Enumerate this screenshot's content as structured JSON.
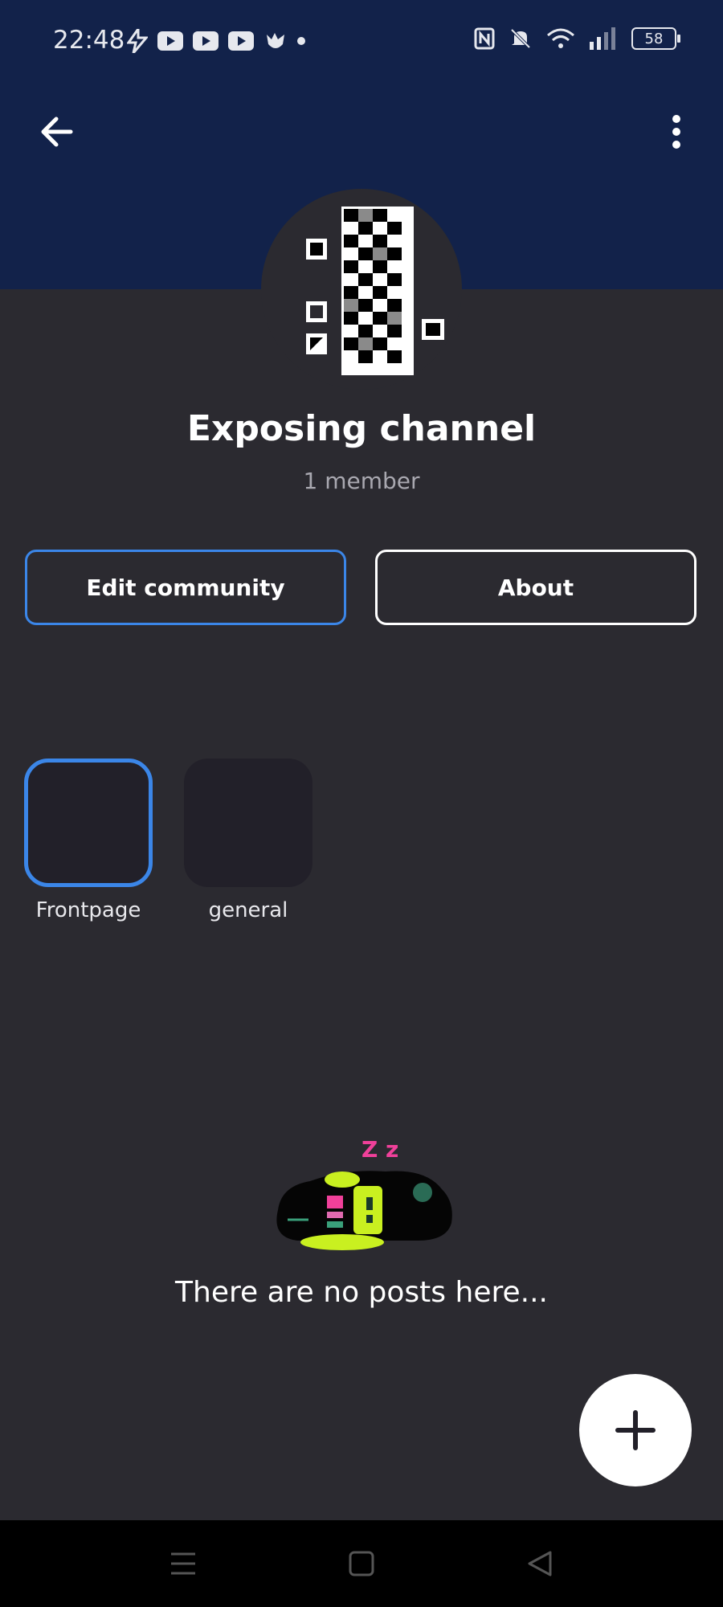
{
  "status_bar": {
    "time": "22:48",
    "battery": "58",
    "icons_left": [
      "flash-icon",
      "youtube-icon",
      "youtube-icon",
      "youtube-icon",
      "bird-icon",
      "dot-icon"
    ],
    "icons_right": [
      "nfc-icon",
      "mute-icon",
      "wifi-icon",
      "signal-icon",
      "battery-icon"
    ]
  },
  "header": {
    "back_icon": "arrow-left-icon",
    "menu_icon": "more-vert-icon"
  },
  "community": {
    "name": "Exposing channel",
    "members": "1 member"
  },
  "actions": {
    "edit_label": "Edit community",
    "about_label": "About"
  },
  "channels": [
    {
      "label": "Frontpage",
      "selected": true
    },
    {
      "label": "general",
      "selected": false
    }
  ],
  "empty_state": {
    "message": "There are no posts here...",
    "zz": "Z z"
  },
  "fab": {
    "icon": "plus-icon"
  },
  "nav_bar": {
    "icons": [
      "menu-icon",
      "home-square-icon",
      "back-triangle-icon"
    ]
  },
  "colors": {
    "header": "#12224a",
    "background": "#2b2a30",
    "accent": "#3b86e8",
    "tile": "#222029"
  }
}
